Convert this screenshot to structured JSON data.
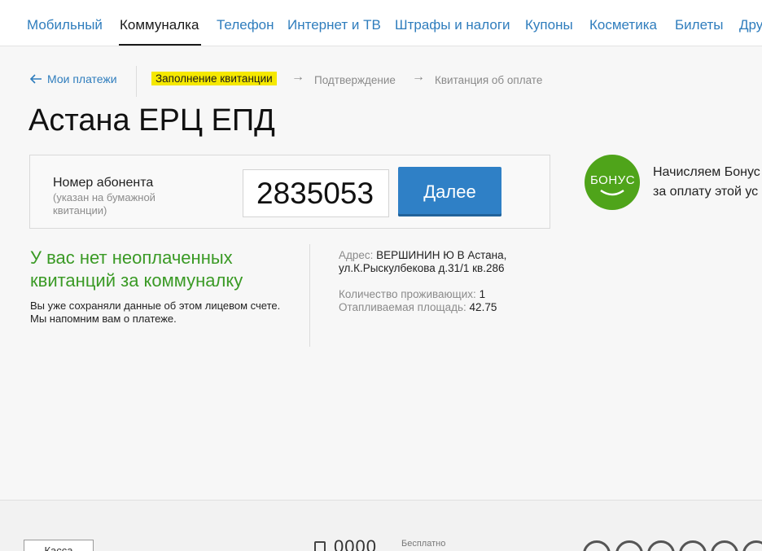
{
  "nav": {
    "tabs": [
      {
        "label": "Мобильный"
      },
      {
        "label": "Коммуналка"
      },
      {
        "label": "Телефон"
      },
      {
        "label": "Интернет и ТВ"
      },
      {
        "label": "Штрафы и налоги"
      },
      {
        "label": "Купоны"
      },
      {
        "label": "Косметика"
      },
      {
        "label": "Билеты"
      },
      {
        "label": "Дру"
      }
    ],
    "active_index": 1
  },
  "breadcrumb": {
    "back_label": "Мои платежи",
    "steps": [
      "Заполнение квитанции",
      "Подтверждение",
      "Квитанция об оплате"
    ],
    "arrow": "→"
  },
  "page_title": "Астана ЕРЦ ЕПД",
  "form": {
    "label": "Номер абонента",
    "hint": "(указан на бумажной квитанции)",
    "account_value": "2835053",
    "next_label": "Далее"
  },
  "bonus": {
    "logo_text": "БОНУС",
    "text_line1": "Начисляем Бонус",
    "text_line2": "за оплату этой ус"
  },
  "status": {
    "title": "У вас нет неоплаченных квитанций за коммуналку",
    "text_line1": "Вы уже сохраняли данные об этом лицевом счете.",
    "text_line2": "Мы напомним вам о платеже."
  },
  "info": {
    "address_key": "Адрес:",
    "address_value": "ВЕРШИНИН Ю В Астана, ул.К.Рыскулбекова д.31/1 кв.286",
    "residents_key": "Количество проживающих:",
    "residents_value": "1",
    "area_key": "Отапливаемая площадь:",
    "area_value": "42.75"
  },
  "footer": {
    "kassa_label": "Касса",
    "phone_text": "0000",
    "free_label": "Бесплатно"
  },
  "colors": {
    "link": "#2f7dbd",
    "button": "#2f80c6",
    "success": "#3a9a25",
    "highlight": "#f5e800",
    "bonus": "#4fa41a"
  }
}
